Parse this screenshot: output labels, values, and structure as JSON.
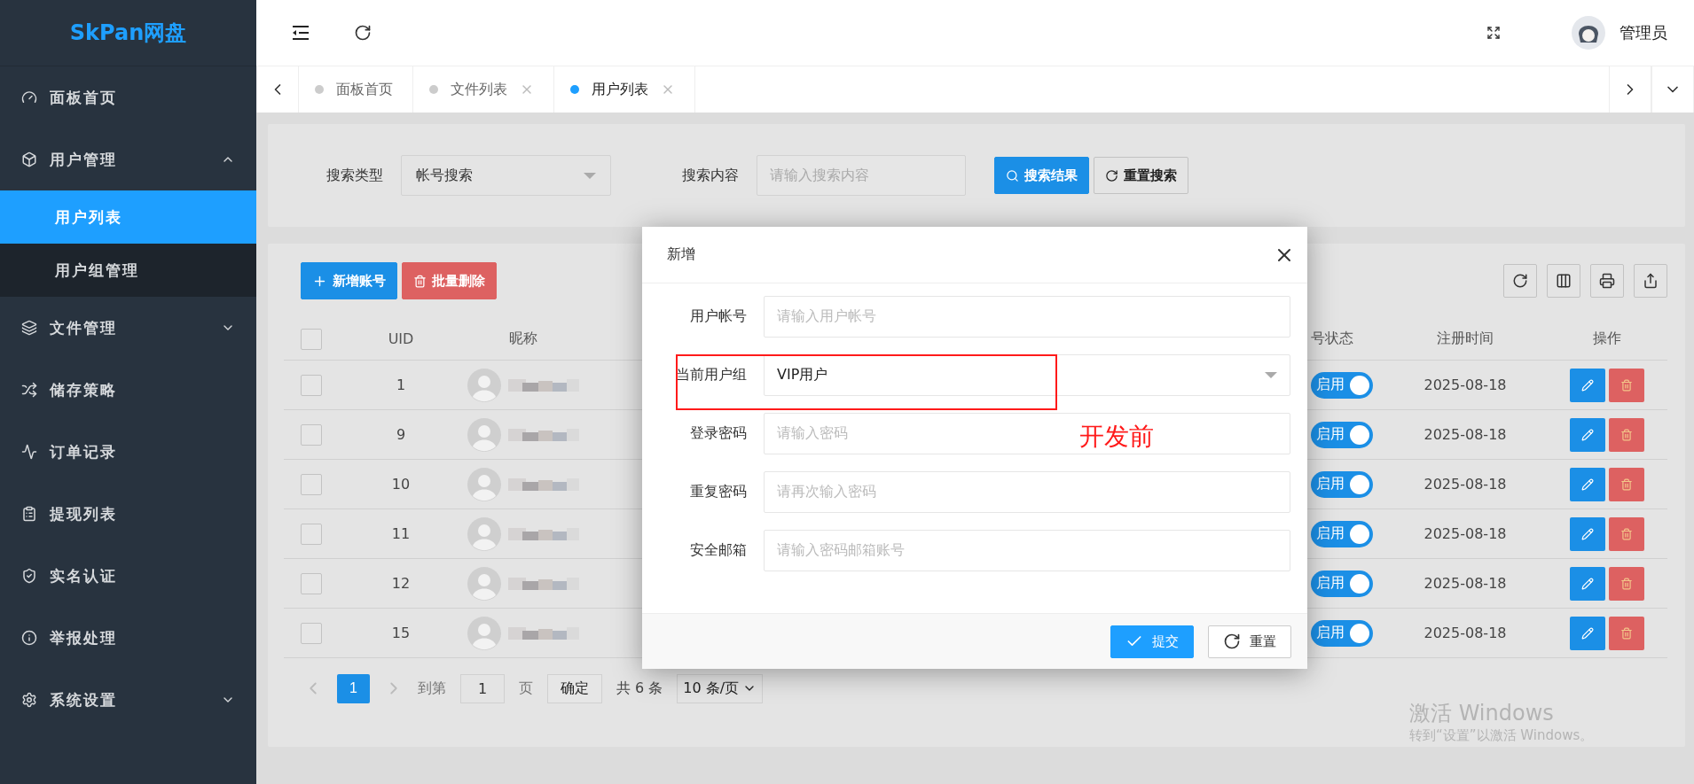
{
  "sidebar": {
    "logo": "SkPan网盘",
    "items": [
      {
        "label": "面板首页",
        "kind": "link",
        "selected": false
      },
      {
        "label": "用户管理",
        "kind": "group",
        "selected": false,
        "expanded": true,
        "children": [
          {
            "label": "用户列表",
            "selected": true
          },
          {
            "label": "用户组管理",
            "selected": false
          }
        ]
      },
      {
        "label": "文件管理",
        "kind": "group",
        "selected": false,
        "expanded": false
      },
      {
        "label": "储存策略",
        "kind": "link",
        "selected": false
      },
      {
        "label": "订单记录",
        "kind": "link",
        "selected": false
      },
      {
        "label": "提现列表",
        "kind": "link",
        "selected": false
      },
      {
        "label": "实名认证",
        "kind": "link",
        "selected": false
      },
      {
        "label": "举报处理",
        "kind": "link",
        "selected": false
      },
      {
        "label": "系统设置",
        "kind": "group",
        "selected": false,
        "expanded": false
      }
    ]
  },
  "header": {
    "user": "管理员"
  },
  "tabs": [
    {
      "label": "面板首页",
      "closable": false,
      "selected": false
    },
    {
      "label": "文件列表",
      "closable": true,
      "selected": false
    },
    {
      "label": "用户列表",
      "closable": true,
      "selected": true
    }
  ],
  "search": {
    "type_label": "搜索类型",
    "type_value": "帐号搜索",
    "content_label": "搜索内容",
    "content_placeholder": "请输入搜索内容",
    "buttons": [
      {
        "label": "搜索结果",
        "kind": "primary"
      },
      {
        "label": "重置搜索",
        "kind": "default"
      }
    ]
  },
  "toolbar": {
    "buttons": [
      {
        "label": "新增账号",
        "kind": "primary"
      },
      {
        "label": "批量删除",
        "kind": "danger"
      }
    ]
  },
  "table": {
    "all_checked": false,
    "columns": [
      "UID",
      "昵称",
      "号状态",
      "注册时间",
      "操作"
    ],
    "rows": [
      {
        "checked": false,
        "uid": "1",
        "status": "启用",
        "on": true,
        "date": "2025-08-18"
      },
      {
        "checked": false,
        "uid": "9",
        "status": "启用",
        "on": true,
        "date": "2025-08-18"
      },
      {
        "checked": false,
        "uid": "10",
        "status": "启用",
        "on": true,
        "date": "2025-08-18"
      },
      {
        "checked": false,
        "uid": "11",
        "status": "启用",
        "on": true,
        "date": "2025-08-18"
      },
      {
        "checked": false,
        "uid": "12",
        "status": "启用",
        "on": true,
        "date": "2025-08-18"
      },
      {
        "checked": false,
        "uid": "15",
        "status": "启用",
        "on": true,
        "date": "2025-08-18"
      }
    ]
  },
  "pagination": {
    "pages": [
      {
        "label": "1",
        "selected": true
      }
    ],
    "goto_label": "到第",
    "goto_value": "1",
    "page_unit": "页",
    "confirm": "确定",
    "total": "共 6 条",
    "page_size": "10 条/页"
  },
  "dialog": {
    "title": "新增",
    "fields": [
      {
        "label": "用户帐号",
        "kind": "input",
        "placeholder": "请输入用户帐号"
      },
      {
        "label": "当前用户组",
        "kind": "select",
        "value": "VIP用户"
      },
      {
        "label": "登录密码",
        "kind": "input",
        "placeholder": "请输入密码"
      },
      {
        "label": "重复密码",
        "kind": "input",
        "placeholder": "请再次输入密码"
      },
      {
        "label": "安全邮箱",
        "kind": "input",
        "placeholder": "请输入密码邮箱账号"
      }
    ],
    "buttons": [
      {
        "label": "提交",
        "kind": "primary"
      },
      {
        "label": "重置",
        "kind": "default"
      }
    ]
  },
  "annotation": {
    "note": "开发前"
  },
  "os_notice": {
    "title": "激活 Windows",
    "subtitle": "转到“设置”以激活 Windows。"
  }
}
